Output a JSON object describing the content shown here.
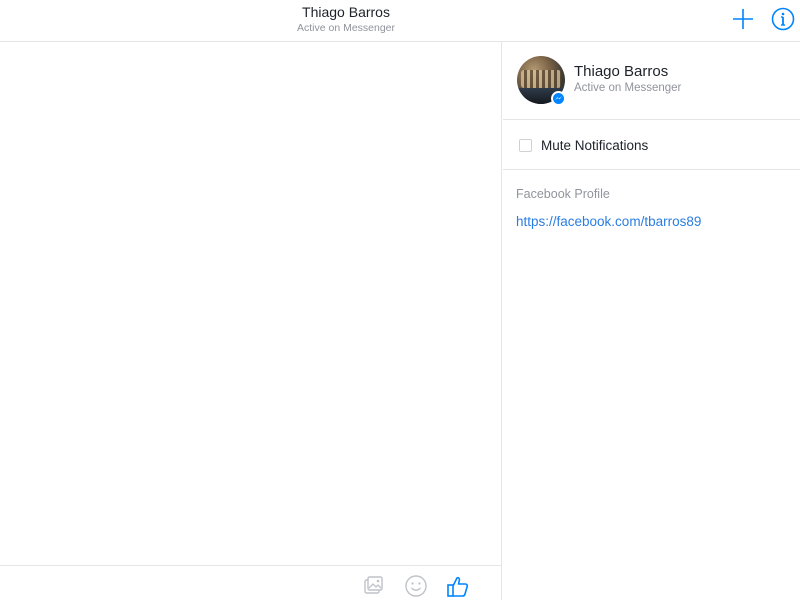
{
  "header": {
    "name": "Thiago Barros",
    "status": "Active on Messenger",
    "icons": {
      "new_message": "plus-icon",
      "info": "info-icon"
    }
  },
  "info_pane": {
    "profile": {
      "name": "Thiago Barros",
      "status": "Active on Messenger",
      "badge_icon": "messenger-badge-icon"
    },
    "mute_label": "Mute Notifications",
    "mute_checked": false,
    "facebook_profile_label": "Facebook Profile",
    "facebook_profile_url": "https://facebook.com/tbarros89"
  },
  "composer": {
    "icons": [
      "photo-icon",
      "emoji-icon",
      "thumbs-up-icon"
    ]
  },
  "colors": {
    "accent": "#0084ff",
    "link": "#2a7de1",
    "muted_text": "#90949c",
    "divider": "#e5e5e5"
  }
}
